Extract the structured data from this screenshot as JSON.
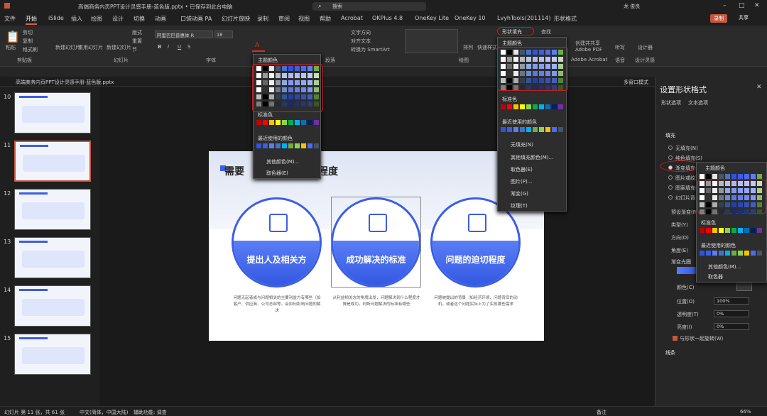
{
  "title_bar": {
    "filename": "高端商务内页PPT设计灵感手册-蓝色版.pptx • 已保存到此台电脑",
    "search": "搜索",
    "user": "龙 俊良"
  },
  "tabs": [
    "文件",
    "开始",
    "iSlide",
    "插入",
    "绘图",
    "设计",
    "切换",
    "动画",
    "口袋动画 PA",
    "幻灯片放映",
    "录制",
    "审阅",
    "视图",
    "帮助",
    "Acrobat",
    "OKPlus 4.8",
    "OneKey Lite",
    "OneKey 10",
    "LvyhTools(201114)",
    "形状格式"
  ],
  "tab_right": {
    "record": "录制",
    "share": "共享"
  },
  "ribbon": {
    "paste": "粘贴",
    "cut": "剪切",
    "copy": "复制",
    "format_painter": "格式刷",
    "clipboard": "剪贴板",
    "new_slide": "新建幻灯片",
    "reuse": "重用幻灯片",
    "slides_group": "幻灯片",
    "layout": "版式",
    "reset": "重置",
    "section": "节",
    "font_name": "阿里巴巴普惠体 R",
    "font_size": "18",
    "font_group": "字体",
    "para_group": "段落",
    "text_dir": "文字方向",
    "align_text": "对齐文本",
    "smartart": "转换为 SmartArt",
    "arrange": "排列",
    "quick_styles": "快速样式",
    "drawing_group": "绘图",
    "shape_fill": "形状填充",
    "find": "查找",
    "create_share_pdf": "创建并共享 Adobe PDF",
    "adobe": "Adobe Acrobat",
    "dictate": "听写",
    "voice": "语音",
    "designer": "设计器",
    "design_ideas": "设计灵感"
  },
  "doc_tab": "高端商务内页PPT设计灵感手册-蓝色版.pptx",
  "multi_window": "多窗口模式",
  "slides": [
    "10",
    "11",
    "12",
    "13",
    "14",
    "15"
  ],
  "slide": {
    "title": "需要",
    "title_end": "的程度",
    "circles": [
      {
        "label": "提出人及相关方",
        "desc": "问题无起者或与问题相关的主要利益方有哪些（如客户、供应商、公司总部等，会如何影响问题的解决"
      },
      {
        "label": "成功解决的标准",
        "desc": "从利益相关方的角度出发，问题解决到什么程度才算是成功，判断问题解决的标准有哪些"
      },
      {
        "label": "问题的迫切程度",
        "desc": "问题被提出的背景（如经济环境、问题背后的动机，或者这个问题实际上为了实现哪些需求"
      }
    ]
  },
  "font_color_popup": {
    "theme": "主题颜色",
    "standard": "标准色",
    "recent": "最近使用的颜色",
    "more": "其他颜色(M)...",
    "eyedropper": "取色器(E)"
  },
  "fill_popup": {
    "theme": "主题颜色",
    "standard": "标准色",
    "recent": "最近使用的颜色",
    "no_fill": "无填充(N)",
    "more_fill": "其他填充颜色(M)...",
    "eyedropper": "取色器(E)",
    "picture": "图片(P)...",
    "gradient": "渐变(G)",
    "texture": "纹理(T)"
  },
  "pane": {
    "title": "设置形状格式",
    "tab1": "形状选项",
    "tab2": "文本选项",
    "fill_section": "填充",
    "fill_options": [
      "无填充(N)",
      "纯色填充(S)",
      "渐变填充(G)",
      "图片或纹理填充(P)",
      "图案填充(A)",
      "幻灯片背景填充(B)"
    ],
    "preset": "预设渐变(R)",
    "type": "类型(Y)",
    "direction": "方向(D)",
    "angle": "角度(E)",
    "stops": "渐变光圈",
    "color": "颜色(C)",
    "position": "位置(O)",
    "position_val": "100%",
    "transparency": "透明度(T)",
    "transparency_val": "0%",
    "brightness": "亮度(I)",
    "brightness_val": "0%",
    "rotate": "与形状一起旋转(W)",
    "line_section": "线条",
    "popup_theme": "主题颜色",
    "popup_standard": "标准色",
    "popup_recent": "最近使用的颜色",
    "popup_more": "其他颜色(M)...",
    "popup_eyedropper": "取色器"
  },
  "status": {
    "slide_info": "幻灯片 第 11 张，共 61 张",
    "lang": "中文(简体，中国大陆)",
    "access": "辅助功能: 调查",
    "notes": "备注",
    "zoom": "66%"
  },
  "colors": {
    "accent": "#3b5ee6",
    "highlight": "#c02020",
    "active_tab": "#e06040"
  },
  "icons": [
    "search-icon",
    "close-icon",
    "paste-icon",
    "shield-icon",
    "checklist-icon",
    "network-icon",
    "gear-icon"
  ]
}
